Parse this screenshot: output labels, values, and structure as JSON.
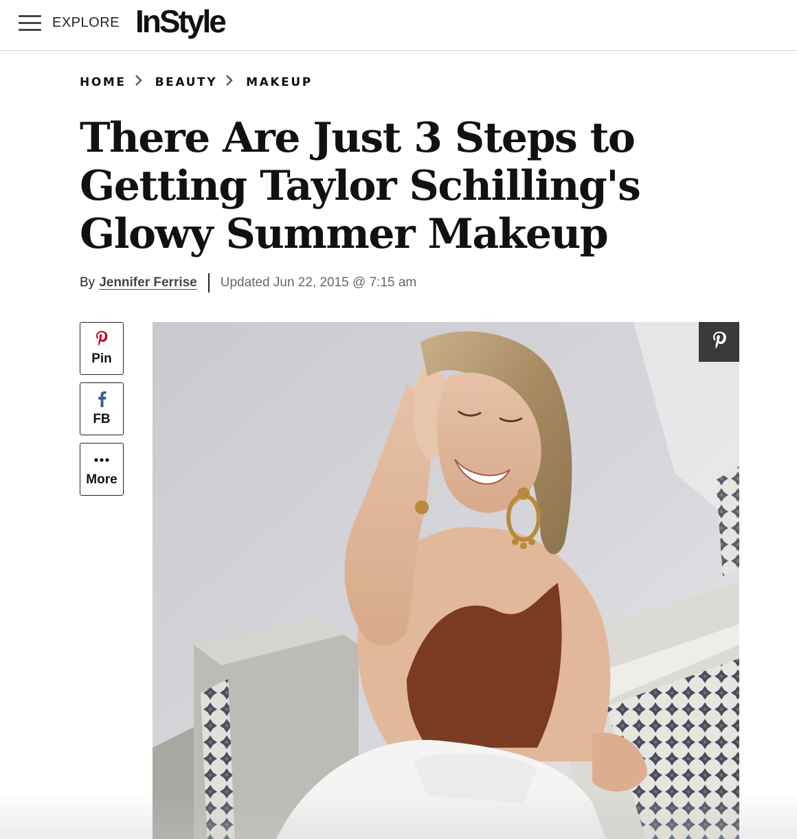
{
  "header": {
    "menu_icon": "hamburger-menu-icon",
    "explore_label": "EXPLORE",
    "logo_text": "InStyle"
  },
  "breadcrumb": {
    "items": [
      "HOME",
      "BEAUTY",
      "MAKEUP"
    ],
    "separator_icon": "chevron-right-icon"
  },
  "article": {
    "title_lines": [
      "There Are Just 3 Steps to",
      "Getting Taylor Schilling's",
      "Glowy Summer Makeup"
    ],
    "byline_prefix": "By",
    "author": "Jennifer Ferrise",
    "updated": "Updated Jun 22, 2015 @ 7:15 am"
  },
  "share": {
    "pin": {
      "label": "Pin",
      "icon": "pinterest-icon",
      "color": "#bd081c"
    },
    "fb": {
      "label": "FB",
      "icon": "facebook-icon",
      "color": "#3b5998"
    },
    "more": {
      "label": "More",
      "icon": "ellipsis-icon"
    }
  },
  "hero": {
    "image": "photo-woman-smiling-sunlight",
    "pin_overlay_icon": "pinterest-icon"
  },
  "colors": {
    "text": "#111111",
    "muted": "#666666",
    "pin_red": "#bd081c",
    "fb_blue": "#3b5998"
  }
}
